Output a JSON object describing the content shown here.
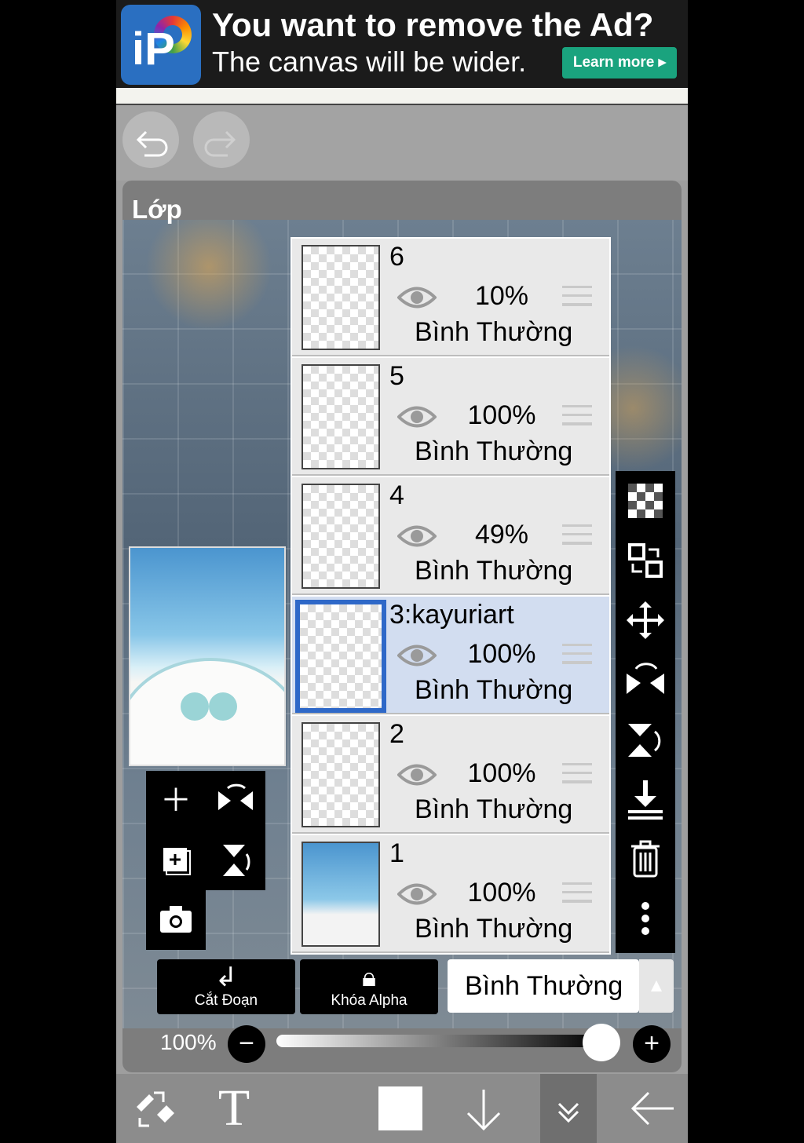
{
  "ad": {
    "title": "You want to remove the Ad?",
    "subtitle": "The canvas will be wider.",
    "button": "Learn more ▸",
    "logo_text": "iP"
  },
  "panel": {
    "title": "Lớp"
  },
  "layers": [
    {
      "name": "6",
      "opacity": "10%",
      "mode": "Bình Thường",
      "selected": false
    },
    {
      "name": "5",
      "opacity": "100%",
      "mode": "Bình Thường",
      "selected": false
    },
    {
      "name": "4",
      "opacity": "49%",
      "mode": "Bình Thường",
      "selected": false
    },
    {
      "name": "3:kayuriart",
      "opacity": "100%",
      "mode": "Bình Thường",
      "selected": true
    },
    {
      "name": "2",
      "opacity": "100%",
      "mode": "Bình Thường",
      "selected": false
    },
    {
      "name": "1",
      "opacity": "100%",
      "mode": "Bình Thường",
      "selected": false
    }
  ],
  "controls": {
    "clip_label": "Cắt Đoạn",
    "alpha_lock_label": "Khóa Alpha",
    "blend_mode": "Bình Thường",
    "opacity_label": "100%",
    "opacity_value": 1.0
  },
  "icons": {
    "undo": "undo-icon",
    "redo": "redo-icon",
    "add_layer": "plus-icon",
    "flip_h": "flip-horizontal-icon",
    "add_copy": "add-copy-icon",
    "flip_v": "flip-vertical-icon",
    "camera": "camera-icon",
    "transparency": "checkerboard-icon",
    "swap": "swap-layer-icon",
    "move": "move-icon",
    "rotate_flip": "rotate-flip-icon",
    "flip_vertical_rotate": "flip-vertical-rotate-icon",
    "merge_down": "merge-down-icon",
    "delete": "trash-icon",
    "more": "more-vertical-icon",
    "pen_eraser": "pen-eraser-icon",
    "text": "text-icon",
    "color": "color-swatch-icon",
    "down": "arrow-down-icon",
    "collapse": "chevron-double-down-icon",
    "back": "arrow-left-icon"
  },
  "colors": {
    "accent_selection": "#2e68c8",
    "ad_button": "#1aa37e"
  }
}
